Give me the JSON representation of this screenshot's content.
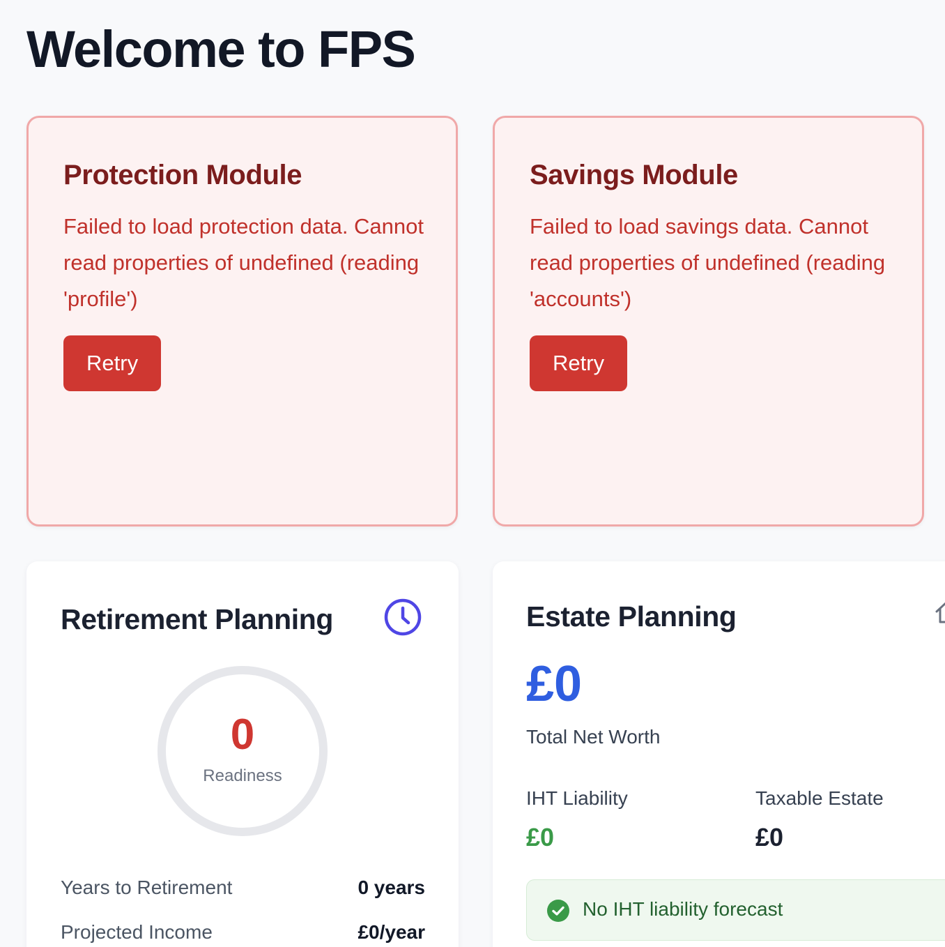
{
  "header": {
    "title": "Welcome to FPS"
  },
  "protection": {
    "title": "Protection Module",
    "error": "Failed to load protection data. Cannot read properties of undefined (reading 'profile')",
    "retry_label": "Retry"
  },
  "savings": {
    "title": "Savings Module",
    "error": "Failed to load savings data. Cannot read properties of undefined (reading 'accounts')",
    "retry_label": "Retry"
  },
  "retirement": {
    "title": "Retirement Planning",
    "icon": "clock-icon",
    "readiness_value": "0",
    "readiness_label": "Readiness",
    "rows": [
      {
        "label": "Years to Retirement",
        "value": "0 years"
      },
      {
        "label": "Projected Income",
        "value": "£0/year"
      }
    ]
  },
  "estate": {
    "title": "Estate Planning",
    "icon": "home-icon",
    "net_worth_value": "£0",
    "net_worth_label": "Total Net Worth",
    "iht_label": "IHT Liability",
    "iht_value": "£0",
    "taxable_label": "Taxable Estate",
    "taxable_value": "£0",
    "notice": "No IHT liability forecast"
  },
  "colors": {
    "error_border": "#f0a8a8",
    "error_text": "#c0312b",
    "retry_button": "#cf3731",
    "accent_blue": "#2f5ee0",
    "accent_purple": "#4f46e5",
    "success_green": "#3a9a48"
  }
}
